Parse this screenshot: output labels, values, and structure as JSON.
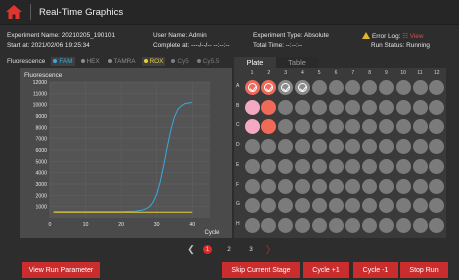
{
  "header": {
    "title": "Real-Time Graphics",
    "home_icon_color": "#e0362f"
  },
  "info": {
    "experiment_name": "Experiment Name: 20210205_190101",
    "user_name": "User Name: Admin",
    "experiment_type": "Experiment Type: Absolute",
    "error_log_label": "Error Log:",
    "error_log_view": "View",
    "start_at": "Start at:  2021/02/06 19:25:34",
    "complete_at": "Complete at: ----/--/-- --:--:--",
    "total_time": "Total Time: --:--:--",
    "run_status": "Run Status: Running"
  },
  "filters": {
    "label": "Fluorescence",
    "channels": [
      {
        "name": "FAM",
        "active": true,
        "color": "#38a8e0"
      },
      {
        "name": "HEX",
        "active": false,
        "color": "#8d8d8d"
      },
      {
        "name": "TAMRA",
        "active": false,
        "color": "#8d8d8d"
      },
      {
        "name": "ROX",
        "active": true,
        "color": "#e4cf3b"
      },
      {
        "name": "Cy5",
        "active": false,
        "color": "#7d7d7d"
      },
      {
        "name": "Cy5.5",
        "active": false,
        "color": "#7d7d7d"
      }
    ]
  },
  "chart_data": {
    "type": "line",
    "title": "Fluorescence",
    "xlabel": "Cycle",
    "ylabel": "",
    "xlim": [
      0,
      45
    ],
    "ylim": [
      0,
      12000
    ],
    "xticks": [
      0,
      10,
      20,
      30,
      40
    ],
    "yticks": [
      1000,
      2000,
      3000,
      4000,
      5000,
      6000,
      7000,
      8000,
      9000,
      10000,
      11000,
      12000
    ],
    "series": [
      {
        "color": "#38a8e0",
        "x": [
          1,
          5,
          10,
          15,
          20,
          24,
          26,
          27,
          28,
          29,
          30,
          31,
          32,
          33,
          34,
          35,
          36,
          37,
          38,
          39,
          40
        ],
        "y": [
          550,
          550,
          550,
          550,
          560,
          600,
          700,
          800,
          1000,
          1400,
          2100,
          3200,
          4700,
          6300,
          7800,
          8900,
          9600,
          9900,
          10100,
          10150,
          10200
        ]
      },
      {
        "color": "#e4cf3b",
        "x": [
          1,
          40
        ],
        "y": [
          500,
          500
        ]
      }
    ]
  },
  "plate": {
    "tabs": [
      "Plate",
      "Table"
    ],
    "active_tab": "Plate",
    "columns": [
      "1",
      "2",
      "3",
      "4",
      "5",
      "6",
      "7",
      "8",
      "9",
      "10",
      "11",
      "12"
    ],
    "rows": [
      "A",
      "B",
      "C",
      "D",
      "E",
      "F",
      "G",
      "H"
    ],
    "colors": {
      "red": "#f06a5a",
      "pink": "#f3a9c2",
      "empty": "#7b7b7b"
    },
    "special_wells": [
      {
        "row": 0,
        "col": 0,
        "type": "red-check"
      },
      {
        "row": 0,
        "col": 1,
        "type": "red-check"
      },
      {
        "row": 0,
        "col": 2,
        "type": "gray-check"
      },
      {
        "row": 0,
        "col": 3,
        "type": "gray-check"
      },
      {
        "row": 1,
        "col": 0,
        "type": "pink"
      },
      {
        "row": 1,
        "col": 1,
        "type": "red"
      },
      {
        "row": 2,
        "col": 0,
        "type": "pink"
      },
      {
        "row": 2,
        "col": 1,
        "type": "red"
      }
    ]
  },
  "pager": {
    "pages": [
      "1",
      "2",
      "3"
    ],
    "current": "1"
  },
  "buttons": {
    "view_run_parameter": "View Run Parameter",
    "skip_current_stage": "Skip Current Stage",
    "cycle_plus": "Cycle +1",
    "cycle_minus": "Cycle -1",
    "stop_run": "Stop Run"
  }
}
